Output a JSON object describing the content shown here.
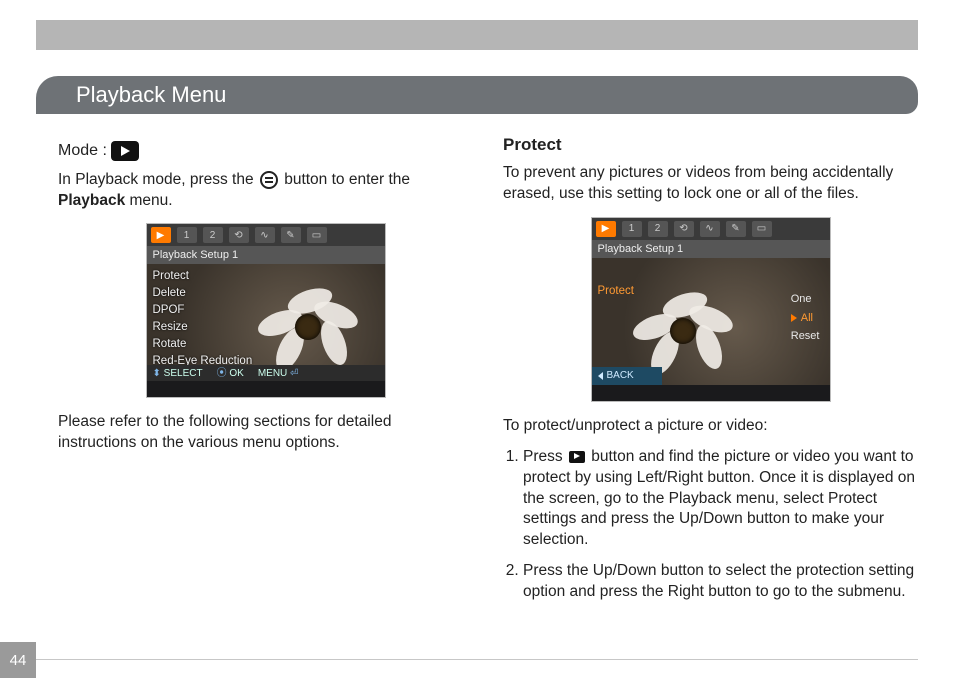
{
  "page_number": "44",
  "section_title": "Playback Menu",
  "left": {
    "mode_label": "Mode :",
    "intro_pre": "In Playback mode, press the ",
    "intro_post": " button to enter the ",
    "intro_bold": "Playback",
    "intro_end": " menu.",
    "refer": "Please refer to the following sections for detailed instructions on the various menu options.",
    "screenshot": {
      "tab_header": "Playback Setup 1",
      "menu_items": [
        "Protect",
        "Delete",
        "DPOF",
        "Resize",
        "Rotate",
        "Red-Eye Reduction"
      ],
      "hints": {
        "select": "SELECT",
        "ok": "OK",
        "menu": "MENU"
      }
    }
  },
  "right": {
    "heading": "Protect",
    "intro": "To prevent any pictures or videos from being accidentally erased, use this setting to lock one or all of the files.",
    "screenshot": {
      "tab_header": "Playback Setup 1",
      "selected_label": "Protect",
      "options": [
        "One",
        "All",
        "Reset"
      ],
      "selected_option_index": 1,
      "back_label": "BACK"
    },
    "steps_intro": "To protect/unprotect a picture or video:",
    "step1_pre": "Press ",
    "step1_post": " button and find the picture or video you want to protect by using Left/Right button. Once it is displayed on the screen, go to the Playback menu, select Protect settings and press the Up/Down button to make your selection.",
    "step2": "Press the Up/Down button to select the protection setting option and press the Right button to go to the submenu."
  },
  "icons": {
    "playback": "playback-icon",
    "menu_button": "menu-button-icon"
  }
}
